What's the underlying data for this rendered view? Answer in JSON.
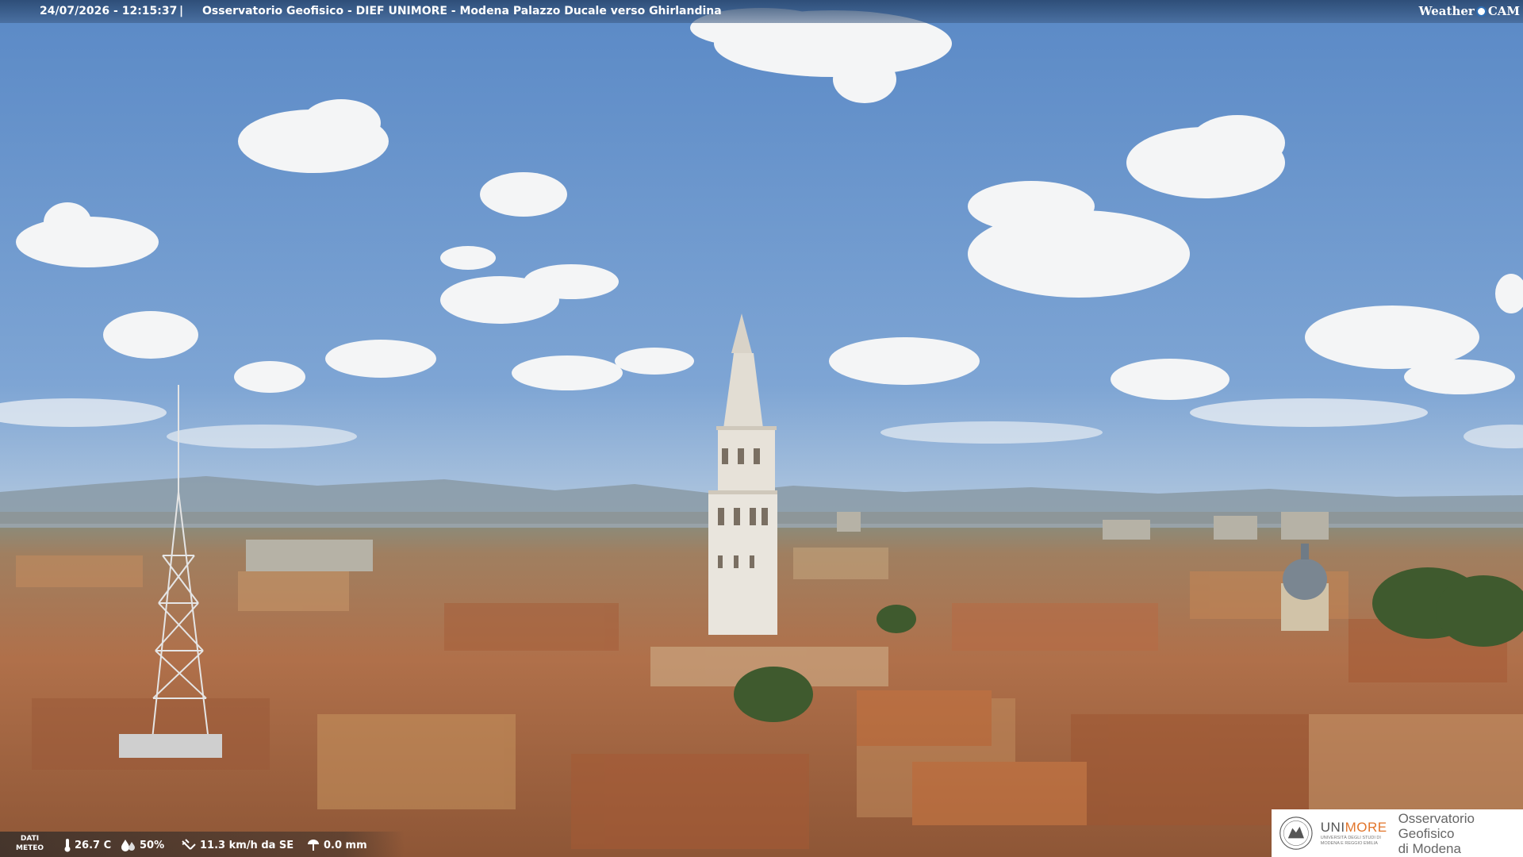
{
  "header": {
    "timestamp": "24/07/2026 - 12:15:37",
    "separator": "|",
    "caption": "Osservatorio Geofisico - DIEF UNIMORE - Modena Palazzo Ducale verso Ghirlandina",
    "brand_left": "Weather",
    "brand_right": "CAM"
  },
  "weather": {
    "dati_line1": "DATI",
    "dati_line2": "METEO",
    "temperature": "26.7 C",
    "humidity": "50%",
    "wind": "11.3 km/h da SE",
    "rain": "0.0 mm",
    "icons": [
      "thermometer-icon",
      "humidity-drop-icon",
      "wind-icon",
      "rain-icon"
    ]
  },
  "logo": {
    "uni_name_a": "UNI",
    "uni_name_b": "MORE",
    "uni_sub_1": "UNIVERSITÀ DEGLI STUDI DI",
    "uni_sub_2": "MODENA E REGGIO EMILIA",
    "obs_line1": "Osservatorio Geofisico",
    "obs_line2": "di Modena"
  },
  "colors": {
    "sky_top": "#5f8dc8",
    "sky_horizon": "#c9d6e2",
    "roofs": "#b5744a",
    "tower": "#e4dfd6",
    "logo_accent": "#e2752b"
  }
}
